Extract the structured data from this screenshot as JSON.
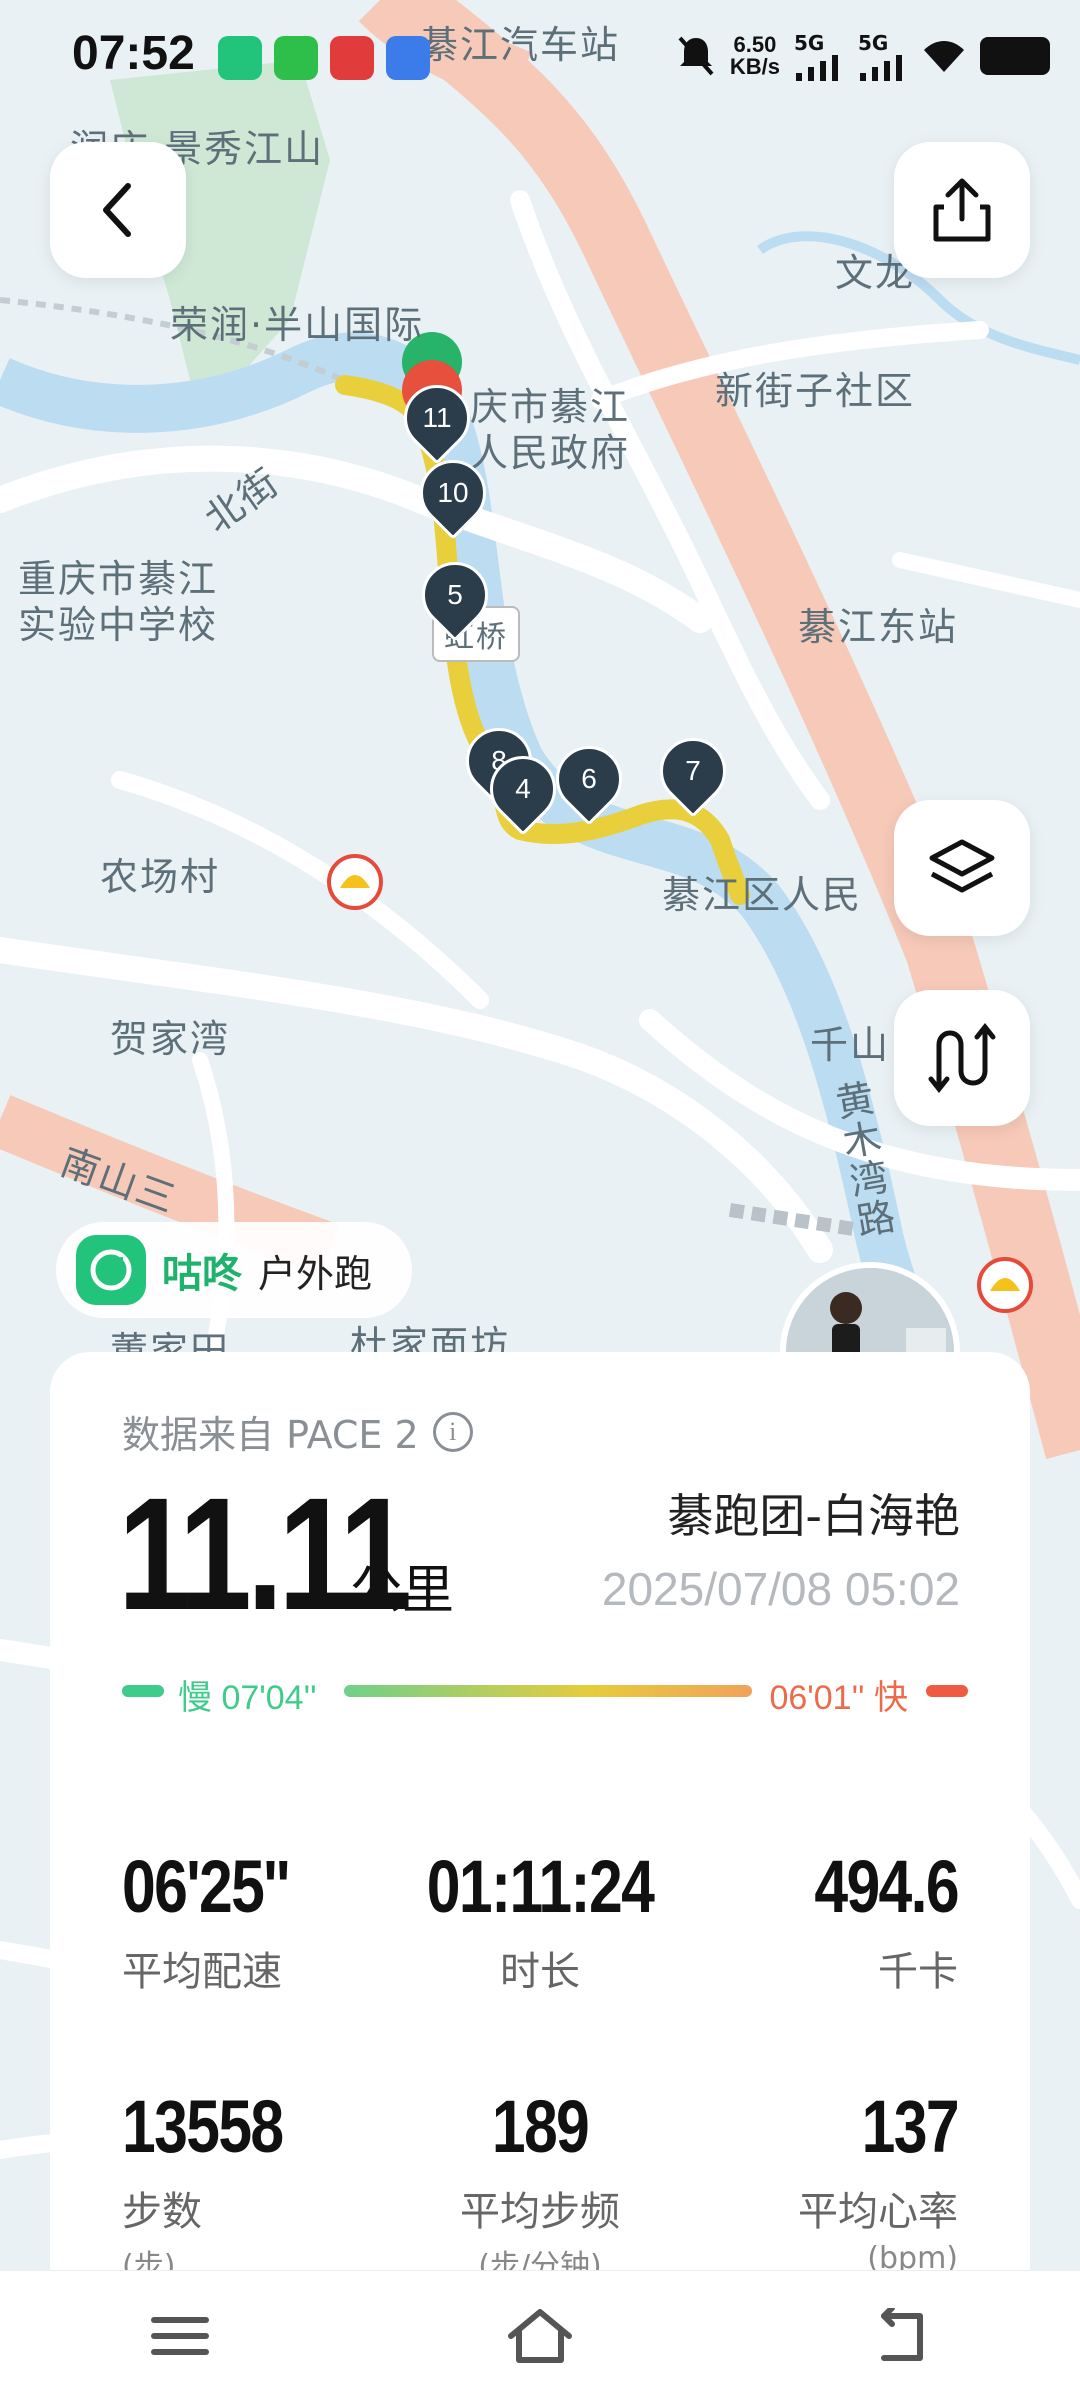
{
  "status_bar": {
    "time": "07:52",
    "speed_value": "6.50",
    "speed_unit": "KB/s",
    "signal_1": "5G",
    "signal_2": "5G",
    "app_icons": [
      "gudong-icon",
      "wechat-icon",
      "jd-618-icon",
      "browser-icon"
    ]
  },
  "map": {
    "labels": {
      "qijiang_bus_station": "綦江汽车站",
      "runqing_jingxiu": "润庆·景秀江山",
      "wenlong": "文龙",
      "rongrun_banshan": "荣润·半山国际",
      "gov_line1": "庆市綦江",
      "gov_line2": "人民政府",
      "xinjiezi": "新街子社区",
      "beijie": "北街",
      "school_line1": "重庆市綦江",
      "school_line2": "实验中学校",
      "hongqiao": "虹桥",
      "qijiang_east": "綦江东站",
      "nongchang": "农场村",
      "district_hospital": "綦江区人民",
      "hejiawan": "贺家湾",
      "qianshan": "千山",
      "huangmuwan": "黄木湾路",
      "nanshan": "南山三",
      "dujia_mianfang": "杜家面坊",
      "dongjiawan": "董家田"
    },
    "markers": [
      "11",
      "10",
      "5",
      "8",
      "4",
      "6",
      "7"
    ]
  },
  "brand": {
    "name": "咕咚",
    "mode": "户外跑"
  },
  "summary": {
    "source": "数据来自 PACE 2",
    "distance": "11.11",
    "distance_unit": "公里",
    "runner": "綦跑团-白海艳",
    "datetime": "2025/07/08 05:02",
    "pace_slow": "慢 07'04''",
    "pace_fast": "06'01'' 快"
  },
  "stats": [
    {
      "value": "06'25''",
      "label": "平均配速",
      "unit": ""
    },
    {
      "value": "01:11:24",
      "label": "时长",
      "unit": ""
    },
    {
      "value": "494.6",
      "label": "千卡",
      "unit": ""
    },
    {
      "value": "13558",
      "label": "步数",
      "unit": "(步)"
    },
    {
      "value": "189",
      "label": "平均步频",
      "unit": "(步/分钟)"
    },
    {
      "value": "137",
      "label": "平均心率",
      "unit": "(bpm)"
    }
  ],
  "colors": {
    "route": "#e9cf3b",
    "marker": "#2b3c4b",
    "brand_green": "#22c37a",
    "river": "#bcdcf2",
    "main_road": "#f6c9b8"
  }
}
